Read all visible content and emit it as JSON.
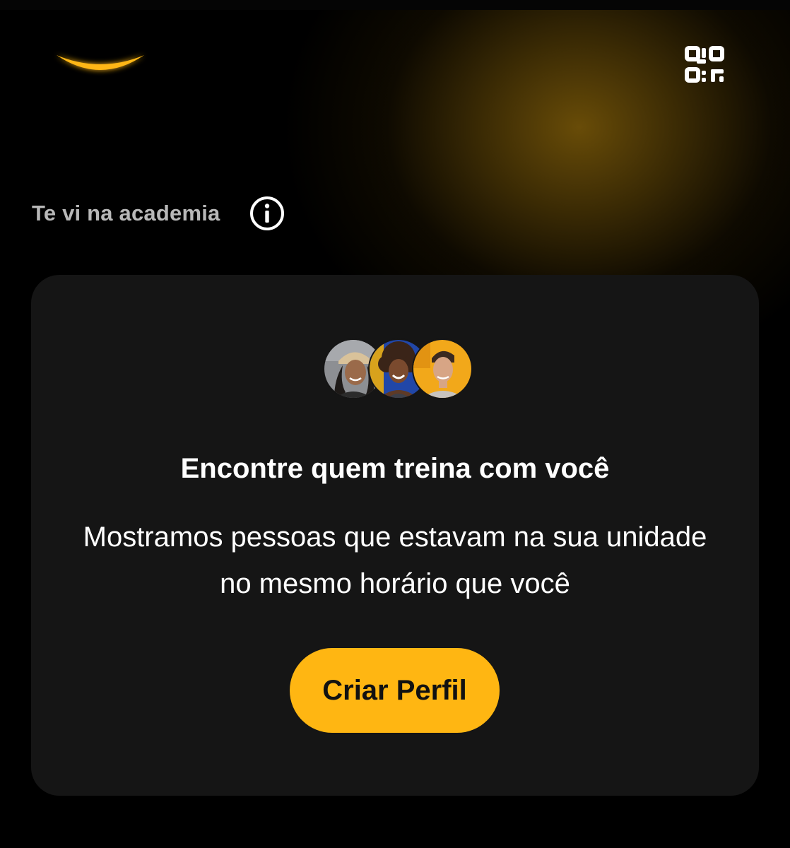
{
  "colors": {
    "background": "#000000",
    "card": "#151515",
    "accent": "#ffb612",
    "glow": "#6e5008",
    "title_muted": "#b8b8b8",
    "text": "#ffffff"
  },
  "header": {
    "logo_icon": "smile-logo-icon",
    "qr_icon": "qr-code-icon"
  },
  "section": {
    "title": "Te vi na academia",
    "info_icon": "info-icon"
  },
  "card": {
    "avatars": [
      "avatar-woman-cap",
      "avatar-woman-curly-hair",
      "avatar-man"
    ],
    "title": "Encontre quem treina com você",
    "description": "Mostramos pessoas que estavam na sua unidade no mesmo horário que você",
    "cta_label": "Criar Perfil"
  }
}
